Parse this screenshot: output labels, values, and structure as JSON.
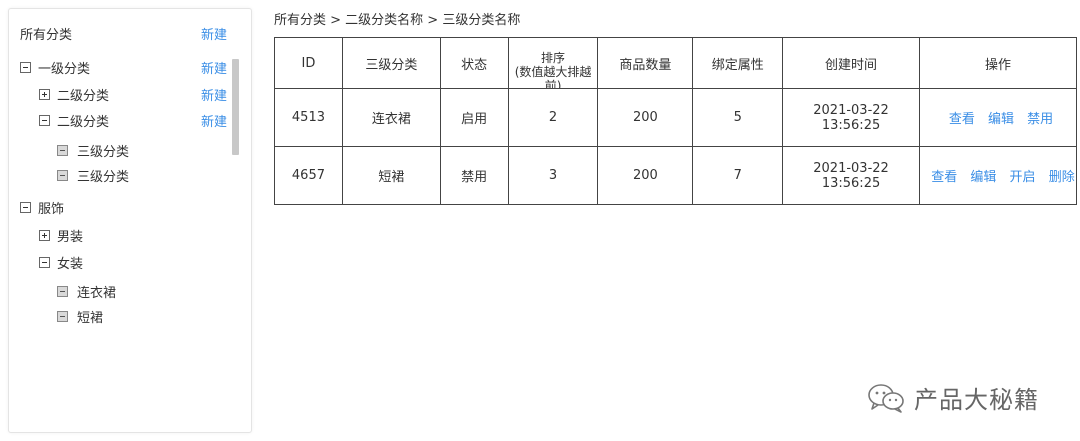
{
  "sidebar": {
    "header": "所有分类",
    "new_label": "新建",
    "tree": [
      {
        "label": "一级分类",
        "expand": "minus"
      },
      {
        "label": "二级分类",
        "expand": "plus"
      },
      {
        "label": "二级分类",
        "expand": "minus"
      },
      {
        "label": "三级分类",
        "expand": "leaf"
      },
      {
        "label": "三级分类",
        "expand": "leaf"
      },
      {
        "label": "服饰",
        "expand": "minus"
      },
      {
        "label": "男装",
        "expand": "plus"
      },
      {
        "label": "女装",
        "expand": "minus"
      },
      {
        "label": "连衣裙",
        "expand": "leaf"
      },
      {
        "label": "短裙",
        "expand": "leaf"
      }
    ]
  },
  "breadcrumb": "所有分类 > 二级分类名称 > 三级分类名称",
  "table": {
    "headers": {
      "id": "ID",
      "name": "三级分类",
      "status": "状态",
      "sort": "排序",
      "sort_note": "(数值越大排越前)",
      "count": "商品数量",
      "attrs": "绑定属性",
      "created": "创建时间",
      "ops": "操作"
    },
    "rows": [
      {
        "id": "4513",
        "name": "连衣裙",
        "status": "启用",
        "sort": "2",
        "count": "200",
        "attrs": "5",
        "created": "2021-03-22 13:56:25",
        "ops": [
          "查看",
          "编辑",
          "禁用"
        ]
      },
      {
        "id": "4657",
        "name": "短裙",
        "status": "禁用",
        "sort": "3",
        "count": "200",
        "attrs": "7",
        "created": "2021-03-22 13:56:25",
        "ops": [
          "查看",
          "编辑",
          "开启",
          "删除"
        ]
      }
    ]
  },
  "watermark": {
    "text": "产品大秘籍",
    "icon": "wechat-icon"
  }
}
